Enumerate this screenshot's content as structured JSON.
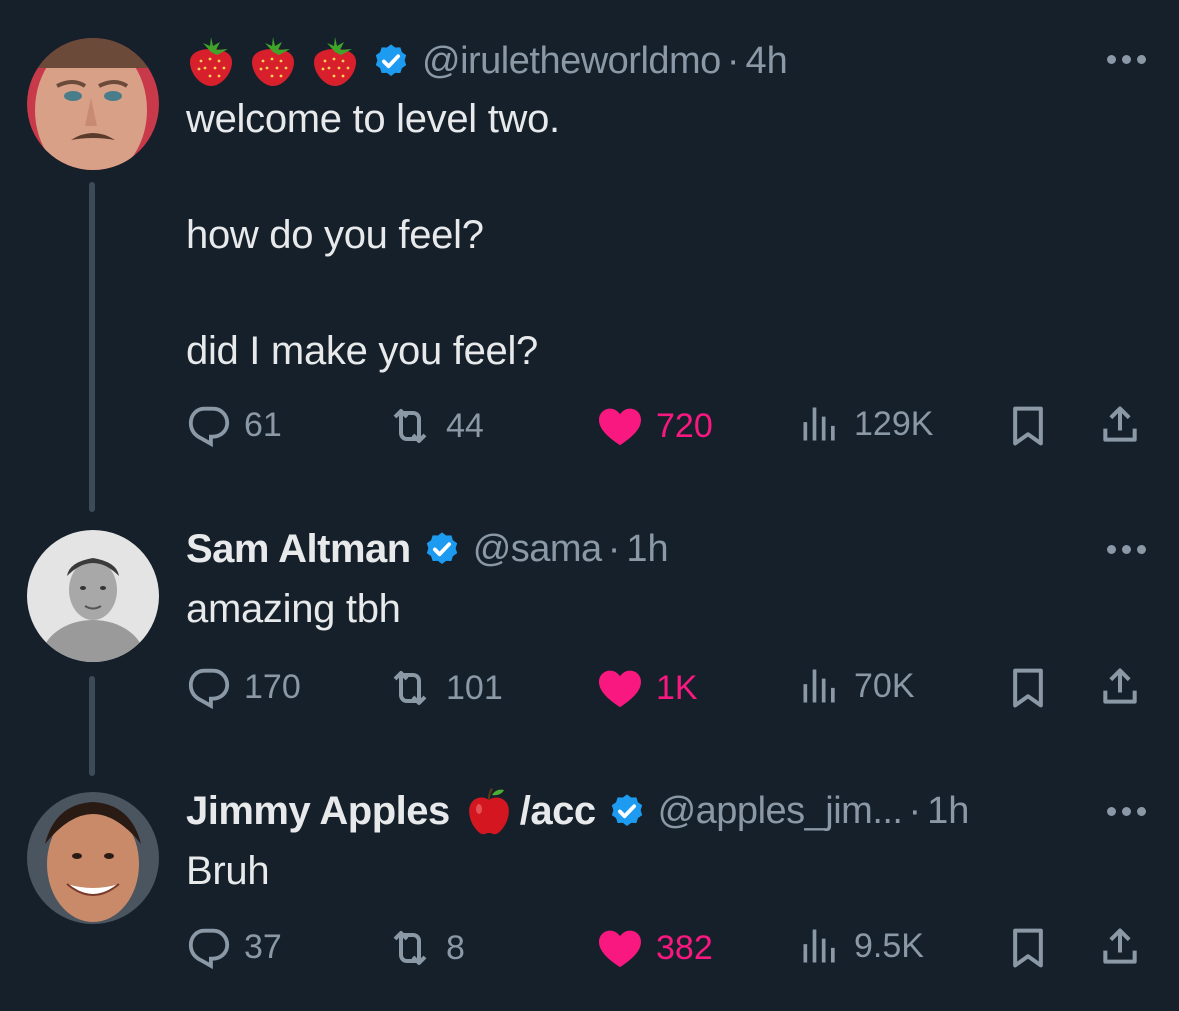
{
  "tweets": [
    {
      "handle": "@iruletheworldmo",
      "dot": "·",
      "time": "4h",
      "text": "welcome to level two.\n\nhow do you feel?\n\ndid I make you feel?",
      "replies": "61",
      "retweets": "44",
      "likes": "720",
      "views": "129K"
    },
    {
      "name": "Sam Altman",
      "handle": "@sama",
      "dot": "·",
      "time": "1h",
      "text": "amazing tbh",
      "replies": "170",
      "retweets": "101",
      "likes": "1K",
      "views": "70K"
    },
    {
      "name": "Jimmy Apples",
      "name_suffix": "/acc",
      "handle": "@apples_jim...",
      "dot": "·",
      "time": "1h",
      "text": "Bruh",
      "replies": "37",
      "retweets": "8",
      "likes": "382",
      "views": "9.5K"
    }
  ],
  "colors": {
    "background": "#15202b",
    "like": "#f91880",
    "verified": "#1d9bf0",
    "muted": "#8b98a5"
  },
  "icons": [
    "strawberry-emoji",
    "verified-badge-icon",
    "more-icon",
    "reply-icon",
    "retweet-icon",
    "heart-icon",
    "views-icon",
    "bookmark-icon",
    "share-icon",
    "apple-emoji"
  ]
}
